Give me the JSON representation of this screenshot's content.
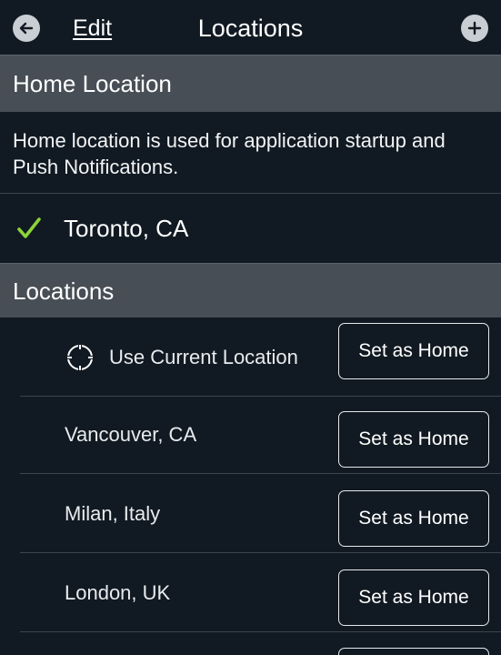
{
  "navbar": {
    "back_icon": "arrow-left-icon",
    "edit_label": "Edit",
    "title": "Locations",
    "add_icon": "plus-icon"
  },
  "home_section": {
    "header": "Home Location",
    "description": "Home location is used for application startup and Push Notifications.",
    "selected_location": "Toronto, CA",
    "selected_icon": "checkmark-icon",
    "accent_color": "#8bd43a"
  },
  "locations_section": {
    "header": "Locations",
    "items": [
      {
        "name": "Use Current Location",
        "icon": "crosshair-icon",
        "button": "Set as Home"
      },
      {
        "name": "Vancouver, CA",
        "button": "Set as Home"
      },
      {
        "name": "Milan, Italy",
        "button": "Set as Home"
      },
      {
        "name": "London, UK",
        "button": "Set as Home"
      }
    ]
  }
}
